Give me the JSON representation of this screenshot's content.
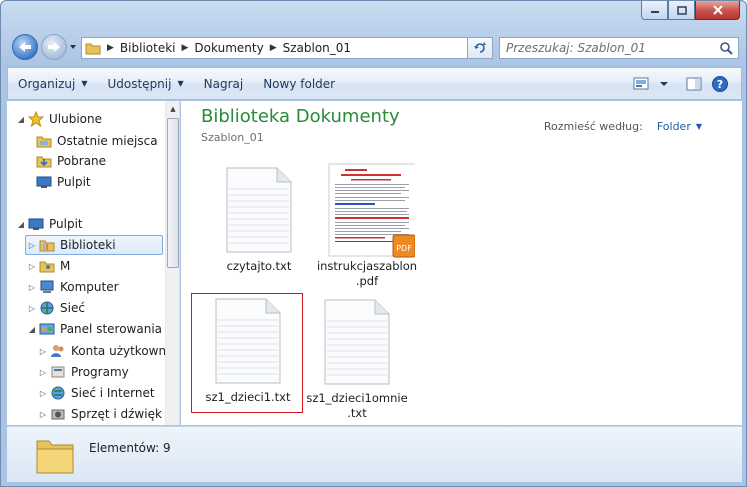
{
  "address": {
    "crumbs": [
      "Biblioteki",
      "Dokumenty",
      "Szablon_01"
    ],
    "search_placeholder": "Przeszukaj: Szablon_01"
  },
  "toolbar": {
    "organize": "Organizuj",
    "share": "Udostępnij",
    "burn": "Nagraj",
    "new_folder": "Nowy folder"
  },
  "nav": {
    "favorites": "Ulubione",
    "recent": "Ostatnie miejsca",
    "downloads": "Pobrane",
    "desktop_fav": "Pulpit",
    "desktop": "Pulpit",
    "libraries": "Biblioteki",
    "user": "M",
    "computer": "Komputer",
    "network": "Sieć",
    "control_panel": "Panel sterowania",
    "user_accounts": "Konta użytkownik",
    "programs": "Programy",
    "network_internet": "Sieć i Internet",
    "hardware_sound": "Sprzęt i dźwięk"
  },
  "library": {
    "title": "Biblioteka Dokumenty",
    "subtitle": "Szablon_01",
    "arrange_label": "Rozmieść według:",
    "arrange_value": "Folder"
  },
  "files": [
    {
      "line1": "czytajto.txt",
      "line2": "",
      "type": "txt"
    },
    {
      "line1": "instrukcjaszablon",
      "line2": ".pdf",
      "type": "pdf"
    },
    {
      "line1": "sz1_dzieci1.txt",
      "line2": "",
      "type": "txt",
      "selected": true
    },
    {
      "line1": "sz1_dzieci1omnie",
      "line2": ".txt",
      "type": "txt"
    }
  ],
  "status": {
    "count": "Elementów: 9"
  },
  "colors": {
    "title_green": "#2a8a3a",
    "link_blue": "#1e5aa8",
    "selection_red": "#d2161e"
  }
}
